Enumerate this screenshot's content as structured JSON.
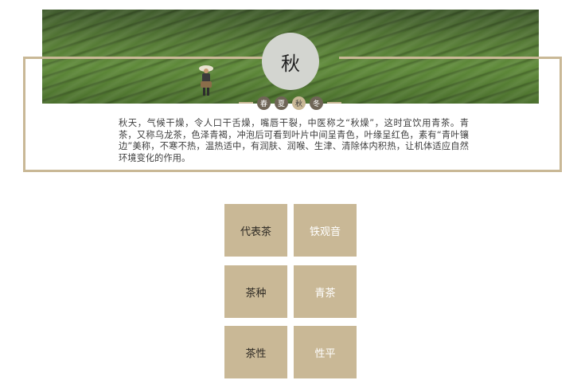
{
  "season": {
    "current": "秋",
    "tabs": [
      "春",
      "夏",
      "秋",
      "冬"
    ],
    "active_index": 2
  },
  "description": "秋天，气候干燥，令人口干舌燥，嘴唇干裂，中医称之“秋燥”，这时宜饮用青茶。青茶，又称乌龙茶，色泽青褐，冲泡后可看到叶片中间呈青色，叶缘呈红色，素有“青叶镶边”美称，不寒不热，温热适中，有润肤、润喉、生津、清除体内积热，让机体适应自然环境变化的作用。",
  "info": [
    {
      "key": "代表茶",
      "value": "铁观音"
    },
    {
      "key": "茶种",
      "value": "青茶"
    },
    {
      "key": "茶性",
      "value": "性平"
    }
  ],
  "colors": {
    "accent": "#c9b896",
    "dot_inactive": "#6f6557",
    "circle": "#d3d5d0"
  }
}
